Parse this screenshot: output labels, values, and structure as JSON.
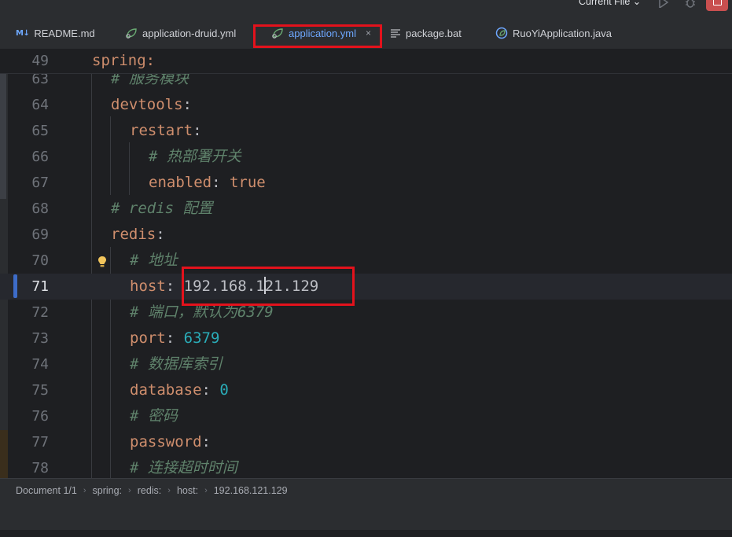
{
  "toolbar": {
    "run_config": "Current File"
  },
  "tabs": [
    {
      "label": "README.md",
      "icon": "markdown-icon"
    },
    {
      "label": "application-druid.yml",
      "icon": "spring-leaf-icon"
    },
    {
      "label": "application.yml",
      "icon": "spring-leaf-icon",
      "active": true,
      "close": "×"
    },
    {
      "label": "package.bat",
      "icon": "text-file-icon"
    },
    {
      "label": "RuoYiApplication.java",
      "icon": "spring-java-icon"
    }
  ],
  "markdown_badge": "M↓",
  "editor": {
    "sticky": {
      "num": "49",
      "text": "spring:"
    },
    "lines": [
      {
        "num": "63",
        "comment": "# 服务模块"
      },
      {
        "num": "64",
        "key": "devtools",
        "colon": ":"
      },
      {
        "num": "65",
        "key": "restart",
        "colon": ":"
      },
      {
        "num": "66",
        "comment": "# 热部署开关"
      },
      {
        "num": "67",
        "key": "enabled",
        "colon": ": ",
        "value": "true"
      },
      {
        "num": "68",
        "comment": "# redis 配置"
      },
      {
        "num": "69",
        "key": "redis",
        "colon": ":"
      },
      {
        "num": "70",
        "comment": "# 地址"
      },
      {
        "num": "71",
        "key": "host",
        "colon": ": ",
        "value_a": "192.168.1",
        "value_b": "21.129"
      },
      {
        "num": "72",
        "comment": "# 端口，默认为6379"
      },
      {
        "num": "73",
        "key": "port",
        "colon": ": ",
        "value": "6379"
      },
      {
        "num": "74",
        "comment": "# 数据库索引"
      },
      {
        "num": "75",
        "key": "database",
        "colon": ": ",
        "value": "0"
      },
      {
        "num": "76",
        "comment": "# 密码"
      },
      {
        "num": "77",
        "key": "password",
        "colon": ":"
      },
      {
        "num": "78",
        "comment": "# 连接超时时间"
      }
    ]
  },
  "breadcrumb": [
    "Document 1/1",
    "spring:",
    "redis:",
    "host:",
    "192.168.121.129"
  ],
  "colors": {
    "highlight": "#e3121c",
    "accent": "#6ea8ff",
    "key": "#cf8e6d",
    "comment": "#5f826b",
    "number": "#2aacb8"
  }
}
